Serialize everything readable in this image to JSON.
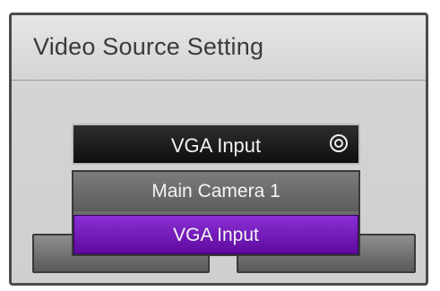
{
  "dialog": {
    "title": "Video Source Setting"
  },
  "select": {
    "current_value": "VGA Input",
    "icon": "select-indicator-icon"
  },
  "dropdown": {
    "options": [
      {
        "label": "Main Camera 1",
        "selected": false
      },
      {
        "label": "VGA Input",
        "selected": true
      }
    ]
  },
  "colors": {
    "selected_option": "#7a1fc4",
    "dialog_background": "#d2d2d2",
    "select_background": "#1a1a1a"
  }
}
